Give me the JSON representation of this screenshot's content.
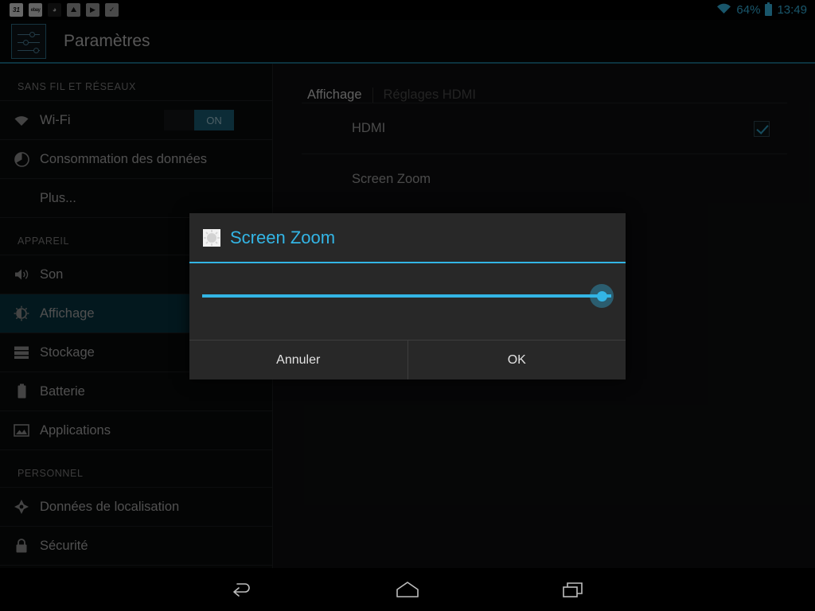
{
  "statusbar": {
    "notifications": [
      {
        "name": "calendar-icon",
        "glyph": "31"
      },
      {
        "name": "ebay-icon",
        "glyph": "ebay"
      },
      {
        "name": "app-notification-icon",
        "glyph": "◕"
      },
      {
        "name": "photo-icon",
        "glyph": "⛰"
      },
      {
        "name": "play-store-icon",
        "glyph": "▶"
      },
      {
        "name": "play-store-installed-icon",
        "glyph": "✓"
      }
    ],
    "battery_percent": "64%",
    "clock": "13:49"
  },
  "appbar": {
    "title": "Paramètres",
    "icon": "settings-sliders-icon"
  },
  "sidebar": {
    "sections": [
      {
        "header": "SANS FIL ET RÉSEAUX",
        "items": [
          {
            "label": "Wi-Fi",
            "icon": "wifi-icon",
            "toggle": "ON",
            "selected": false
          },
          {
            "label": "Consommation des données",
            "icon": "data-usage-icon",
            "selected": false
          },
          {
            "label": "Plus...",
            "icon": null,
            "selected": false
          }
        ]
      },
      {
        "header": "APPAREIL",
        "items": [
          {
            "label": "Son",
            "icon": "sound-icon",
            "selected": false
          },
          {
            "label": "Affichage",
            "icon": "brightness-icon",
            "selected": true
          },
          {
            "label": "Stockage",
            "icon": "storage-icon",
            "selected": false
          },
          {
            "label": "Batterie",
            "icon": "battery-icon",
            "selected": false
          },
          {
            "label": "Applications",
            "icon": "applications-icon",
            "selected": false
          }
        ]
      },
      {
        "header": "PERSONNEL",
        "items": [
          {
            "label": "Données de localisation",
            "icon": "location-icon",
            "selected": false
          },
          {
            "label": "Sécurité",
            "icon": "lock-icon",
            "selected": false
          }
        ]
      }
    ]
  },
  "content": {
    "tabs": [
      {
        "label": "Affichage",
        "active": true
      },
      {
        "label": "Réglages HDMI",
        "active": false
      }
    ],
    "prefs": [
      {
        "label": "HDMI",
        "checkbox": true
      },
      {
        "label": "Screen Zoom",
        "checkbox": false
      }
    ]
  },
  "dialog": {
    "icon": "brightness-sun-icon",
    "title": "Screen Zoom",
    "slider_value": 100,
    "slider_min": 0,
    "slider_max": 100,
    "buttons": {
      "cancel": "Annuler",
      "ok": "OK"
    }
  },
  "navbar": {
    "back": "back-icon",
    "home": "home-icon",
    "recents": "recents-icon"
  },
  "colors": {
    "accent": "#33b5e5",
    "selected_row": "#08323f",
    "status_text": "#35b4e0"
  }
}
